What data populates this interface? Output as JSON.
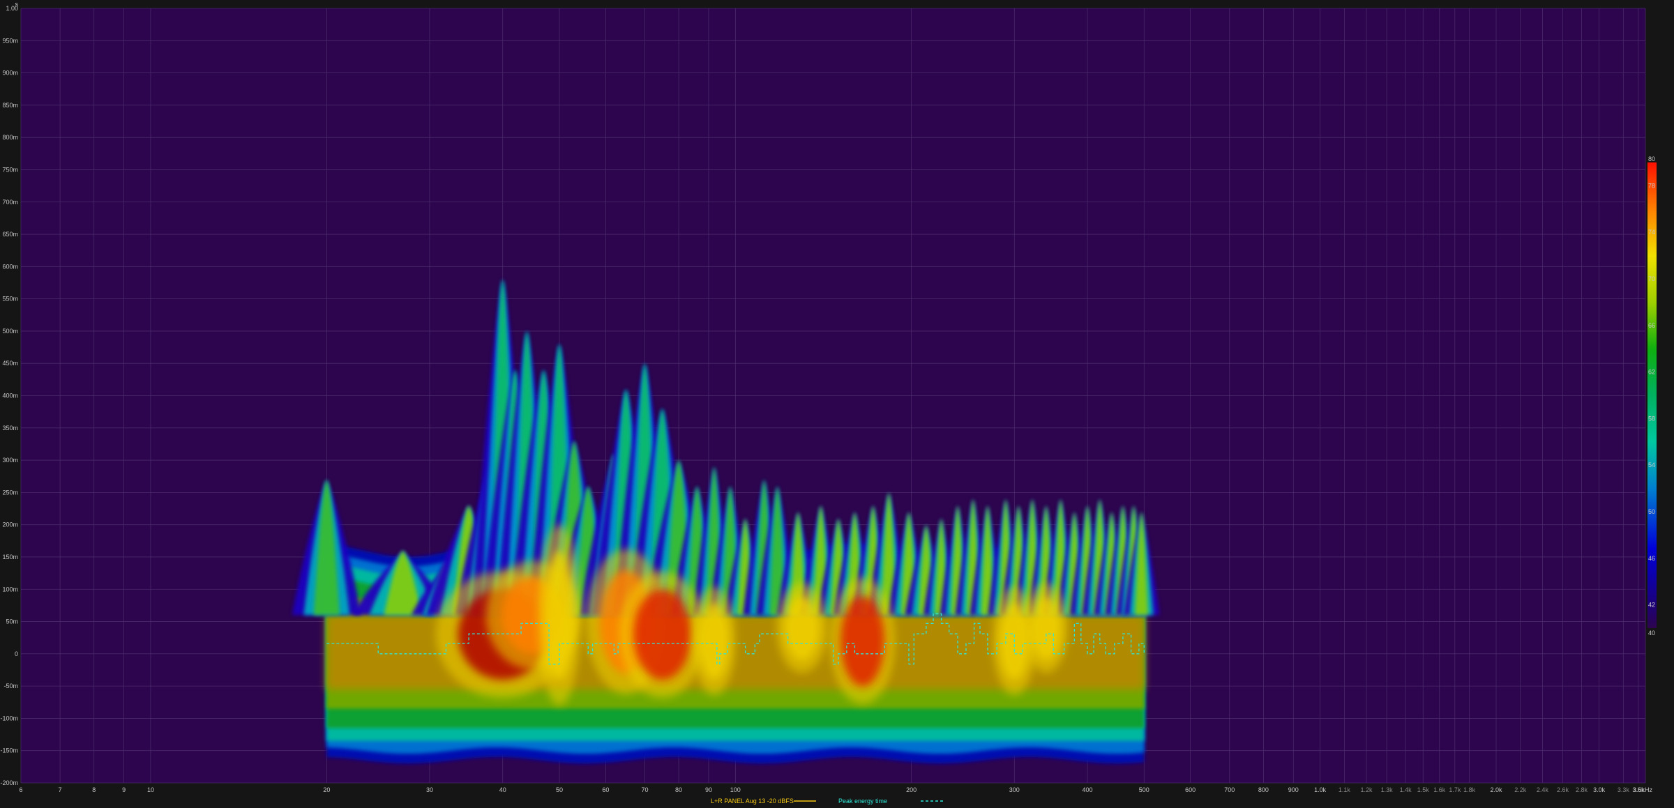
{
  "chart_data": {
    "type": "heatmap",
    "title": "",
    "xlabel": "",
    "ylabel": "",
    "x_scale": "log",
    "xlim_hz": [
      6,
      3600
    ],
    "ylim_s": [
      -0.2,
      1.0
    ],
    "grid": true,
    "corner_label": "s",
    "x_ticks": [
      {
        "v": 6,
        "label": "6"
      },
      {
        "v": 7,
        "label": "7"
      },
      {
        "v": 8,
        "label": "8"
      },
      {
        "v": 9,
        "label": "9"
      },
      {
        "v": 10,
        "label": "10"
      },
      {
        "v": 20,
        "label": "20"
      },
      {
        "v": 30,
        "label": "30"
      },
      {
        "v": 40,
        "label": "40"
      },
      {
        "v": 50,
        "label": "50"
      },
      {
        "v": 60,
        "label": "60"
      },
      {
        "v": 70,
        "label": "70"
      },
      {
        "v": 80,
        "label": "80"
      },
      {
        "v": 90,
        "label": "90"
      },
      {
        "v": 100,
        "label": "100"
      },
      {
        "v": 200,
        "label": "200"
      },
      {
        "v": 300,
        "label": "300"
      },
      {
        "v": 400,
        "label": "400"
      },
      {
        "v": 500,
        "label": "500"
      },
      {
        "v": 600,
        "label": "600"
      },
      {
        "v": 700,
        "label": "700"
      },
      {
        "v": 800,
        "label": "800"
      },
      {
        "v": 900,
        "label": "900"
      },
      {
        "v": 1000,
        "label": "1.0k"
      },
      {
        "v": 1100,
        "label": "1.1k",
        "minor": true
      },
      {
        "v": 1200,
        "label": "1.2k",
        "minor": true
      },
      {
        "v": 1300,
        "label": "1.3k",
        "minor": true
      },
      {
        "v": 1400,
        "label": "1.4k",
        "minor": true
      },
      {
        "v": 1500,
        "label": "1.5k",
        "minor": true
      },
      {
        "v": 1600,
        "label": "1.6k",
        "minor": true
      },
      {
        "v": 1700,
        "label": "1.7k",
        "minor": true
      },
      {
        "v": 1800,
        "label": "1.8k",
        "minor": true
      },
      {
        "v": 2000,
        "label": "2.0k"
      },
      {
        "v": 2200,
        "label": "2.2k",
        "minor": true
      },
      {
        "v": 2400,
        "label": "2.4k",
        "minor": true
      },
      {
        "v": 2600,
        "label": "2.6k",
        "minor": true
      },
      {
        "v": 2800,
        "label": "2.8k",
        "minor": true
      },
      {
        "v": 3000,
        "label": "3.0k"
      },
      {
        "v": 3300,
        "label": "3.3k",
        "minor": true
      },
      {
        "v": 3500,
        "label": "3.5k",
        "minor": true
      },
      {
        "v": 3600,
        "label": "3.6kHz"
      }
    ],
    "y_ticks": [
      {
        "v": 1.0,
        "label": "1.00"
      },
      {
        "v": 0.95,
        "label": "950m"
      },
      {
        "v": 0.9,
        "label": "900m"
      },
      {
        "v": 0.85,
        "label": "850m"
      },
      {
        "v": 0.8,
        "label": "800m"
      },
      {
        "v": 0.75,
        "label": "750m"
      },
      {
        "v": 0.7,
        "label": "700m"
      },
      {
        "v": 0.65,
        "label": "650m"
      },
      {
        "v": 0.6,
        "label": "600m"
      },
      {
        "v": 0.55,
        "label": "550m"
      },
      {
        "v": 0.5,
        "label": "500m"
      },
      {
        "v": 0.45,
        "label": "450m"
      },
      {
        "v": 0.4,
        "label": "400m"
      },
      {
        "v": 0.35,
        "label": "350m"
      },
      {
        "v": 0.3,
        "label": "300m"
      },
      {
        "v": 0.25,
        "label": "250m"
      },
      {
        "v": 0.2,
        "label": "200m"
      },
      {
        "v": 0.15,
        "label": "150m"
      },
      {
        "v": 0.1,
        "label": "100m"
      },
      {
        "v": 0.05,
        "label": "50m"
      },
      {
        "v": 0.0,
        "label": "0"
      },
      {
        "v": -0.05,
        "label": "-50m"
      },
      {
        "v": -0.1,
        "label": "-100m"
      },
      {
        "v": -0.15,
        "label": "-150m"
      },
      {
        "v": -0.2,
        "label": "-200m"
      }
    ],
    "colorbar": {
      "min": 40,
      "max": 80,
      "ticks": [
        {
          "v": 80,
          "label": "80"
        },
        {
          "v": 78,
          "label": "78"
        },
        {
          "v": 74,
          "label": "74"
        },
        {
          "v": 70,
          "label": "70"
        },
        {
          "v": 66,
          "label": "66"
        },
        {
          "v": 62,
          "label": "62"
        },
        {
          "v": 58,
          "label": "58"
        },
        {
          "v": 54,
          "label": "54"
        },
        {
          "v": 50,
          "label": "50"
        },
        {
          "v": 46,
          "label": "46"
        },
        {
          "v": 42,
          "label": "42"
        },
        {
          "v": 40,
          "label": "40"
        }
      ]
    },
    "heatmap_extent": {
      "f_min_hz": 20,
      "f_max_hz": 500,
      "onset_s_at_20hz": 0.16,
      "tail_s": -0.16
    },
    "decay_peaks": [
      {
        "f": 20,
        "t": 0.27,
        "w": 0.02
      },
      {
        "f": 27,
        "t": 0.16,
        "w": 0.03
      },
      {
        "f": 32,
        "t": 0.14,
        "w": 0.02
      },
      {
        "f": 35,
        "t": 0.23,
        "w": 0.025
      },
      {
        "f": 38,
        "t": 0.29,
        "w": 0.02
      },
      {
        "f": 40,
        "t": 0.58,
        "w": 0.018
      },
      {
        "f": 42,
        "t": 0.44,
        "w": 0.02
      },
      {
        "f": 44,
        "t": 0.5,
        "w": 0.018
      },
      {
        "f": 47,
        "t": 0.44,
        "w": 0.02
      },
      {
        "f": 50,
        "t": 0.48,
        "w": 0.018
      },
      {
        "f": 53,
        "t": 0.33,
        "w": 0.02
      },
      {
        "f": 56,
        "t": 0.26,
        "w": 0.02
      },
      {
        "f": 62,
        "t": 0.31,
        "w": 0.02
      },
      {
        "f": 65,
        "t": 0.41,
        "w": 0.02
      },
      {
        "f": 70,
        "t": 0.45,
        "w": 0.018
      },
      {
        "f": 75,
        "t": 0.38,
        "w": 0.02
      },
      {
        "f": 80,
        "t": 0.3,
        "w": 0.02
      },
      {
        "f": 86,
        "t": 0.26,
        "w": 0.015
      },
      {
        "f": 92,
        "t": 0.29,
        "w": 0.012
      },
      {
        "f": 98,
        "t": 0.26,
        "w": 0.012
      },
      {
        "f": 104,
        "t": 0.21,
        "w": 0.012
      },
      {
        "f": 112,
        "t": 0.27,
        "w": 0.012
      },
      {
        "f": 118,
        "t": 0.26,
        "w": 0.012
      },
      {
        "f": 128,
        "t": 0.22,
        "w": 0.012
      },
      {
        "f": 140,
        "t": 0.23,
        "w": 0.012
      },
      {
        "f": 150,
        "t": 0.21,
        "w": 0.012
      },
      {
        "f": 160,
        "t": 0.22,
        "w": 0.012
      },
      {
        "f": 172,
        "t": 0.23,
        "w": 0.012
      },
      {
        "f": 183,
        "t": 0.25,
        "w": 0.012
      },
      {
        "f": 198,
        "t": 0.22,
        "w": 0.012
      },
      {
        "f": 212,
        "t": 0.2,
        "w": 0.012
      },
      {
        "f": 225,
        "t": 0.21,
        "w": 0.01
      },
      {
        "f": 240,
        "t": 0.23,
        "w": 0.01
      },
      {
        "f": 255,
        "t": 0.24,
        "w": 0.01
      },
      {
        "f": 270,
        "t": 0.23,
        "w": 0.01
      },
      {
        "f": 290,
        "t": 0.24,
        "w": 0.01
      },
      {
        "f": 305,
        "t": 0.23,
        "w": 0.01
      },
      {
        "f": 322,
        "t": 0.24,
        "w": 0.01
      },
      {
        "f": 340,
        "t": 0.23,
        "w": 0.01
      },
      {
        "f": 360,
        "t": 0.24,
        "w": 0.01
      },
      {
        "f": 380,
        "t": 0.22,
        "w": 0.01
      },
      {
        "f": 400,
        "t": 0.23,
        "w": 0.01
      },
      {
        "f": 420,
        "t": 0.24,
        "w": 0.01
      },
      {
        "f": 440,
        "t": 0.22,
        "w": 0.01
      },
      {
        "f": 460,
        "t": 0.23,
        "w": 0.01
      },
      {
        "f": 480,
        "t": 0.23,
        "w": 0.01
      },
      {
        "f": 495,
        "t": 0.22,
        "w": 0.01
      }
    ],
    "hot_spots": [
      {
        "f": 40,
        "t": 0.03,
        "ft": 0.16,
        "tt": 0.07,
        "level": 80
      },
      {
        "f": 45,
        "t": 0.06,
        "ft": 0.1,
        "tt": 0.06,
        "level": 76
      },
      {
        "f": 65,
        "t": 0.05,
        "ft": 0.08,
        "tt": 0.08,
        "level": 76
      },
      {
        "f": 75,
        "t": 0.03,
        "ft": 0.09,
        "tt": 0.07,
        "level": 78
      },
      {
        "f": 50,
        "t": 0.06,
        "ft": 0.03,
        "tt": 0.1,
        "level": 70
      },
      {
        "f": 92,
        "t": 0.02,
        "ft": 0.03,
        "tt": 0.06,
        "level": 72
      },
      {
        "f": 130,
        "t": 0.04,
        "ft": 0.04,
        "tt": 0.05,
        "level": 72
      },
      {
        "f": 165,
        "t": 0.02,
        "ft": 0.06,
        "tt": 0.07,
        "level": 78
      },
      {
        "f": 300,
        "t": 0.02,
        "ft": 0.03,
        "tt": 0.06,
        "level": 72
      },
      {
        "f": 340,
        "t": 0.04,
        "ft": 0.03,
        "tt": 0.05,
        "level": 70
      }
    ],
    "series": [
      {
        "name": "L+R PANEL Aug 13 -20 dBFS",
        "style": "solid",
        "values": []
      },
      {
        "name": "Peak energy time",
        "style": "dashed",
        "x": [
          20,
          24,
          24.5,
          31,
          32,
          34,
          35,
          42,
          43,
          47,
          48,
          49,
          50,
          51,
          53,
          56,
          57,
          62,
          63,
          65,
          67,
          70,
          71,
          92,
          93,
          94,
          95,
          97,
          99,
          104,
          105,
          108,
          110,
          120,
          123,
          145,
          147,
          150,
          155,
          160,
          165,
          175,
          180,
          190,
          198,
          202,
          212,
          218,
          225,
          232,
          240,
          248,
          256,
          262,
          270,
          280,
          290,
          300,
          310,
          325,
          340,
          350,
          365,
          380,
          390,
          400,
          410,
          420,
          430,
          445,
          460,
          475,
          490,
          500
        ],
        "y": [
          0.016,
          0.016,
          0.0,
          0.0,
          0.016,
          0.016,
          0.031,
          0.031,
          0.047,
          0.047,
          -0.016,
          -0.016,
          0.016,
          0.016,
          0.016,
          0.0,
          0.016,
          0.0,
          0.016,
          0.016,
          0.016,
          0.016,
          0.016,
          0.016,
          -0.016,
          0.0,
          0.0,
          0.016,
          0.016,
          0.0,
          0.0,
          0.016,
          0.031,
          0.031,
          0.016,
          0.016,
          -0.016,
          0.0,
          0.016,
          0.0,
          0.0,
          0.0,
          0.016,
          0.016,
          -0.016,
          0.031,
          0.047,
          0.062,
          0.047,
          0.031,
          0.0,
          0.016,
          0.047,
          0.031,
          0.0,
          0.016,
          0.031,
          0.0,
          0.016,
          0.016,
          0.031,
          0.0,
          0.016,
          0.047,
          0.016,
          0.0,
          0.031,
          0.016,
          0.0,
          0.016,
          0.031,
          0.0,
          0.016,
          0.0
        ]
      }
    ],
    "colors": {
      "background": "#151515",
      "plot_bg": "#2d044e",
      "grid": "#4a2a6a",
      "solid_legend": "#f3c613",
      "dashed_series": "#2ee6d6",
      "label_text": "#c8c8c8"
    }
  }
}
